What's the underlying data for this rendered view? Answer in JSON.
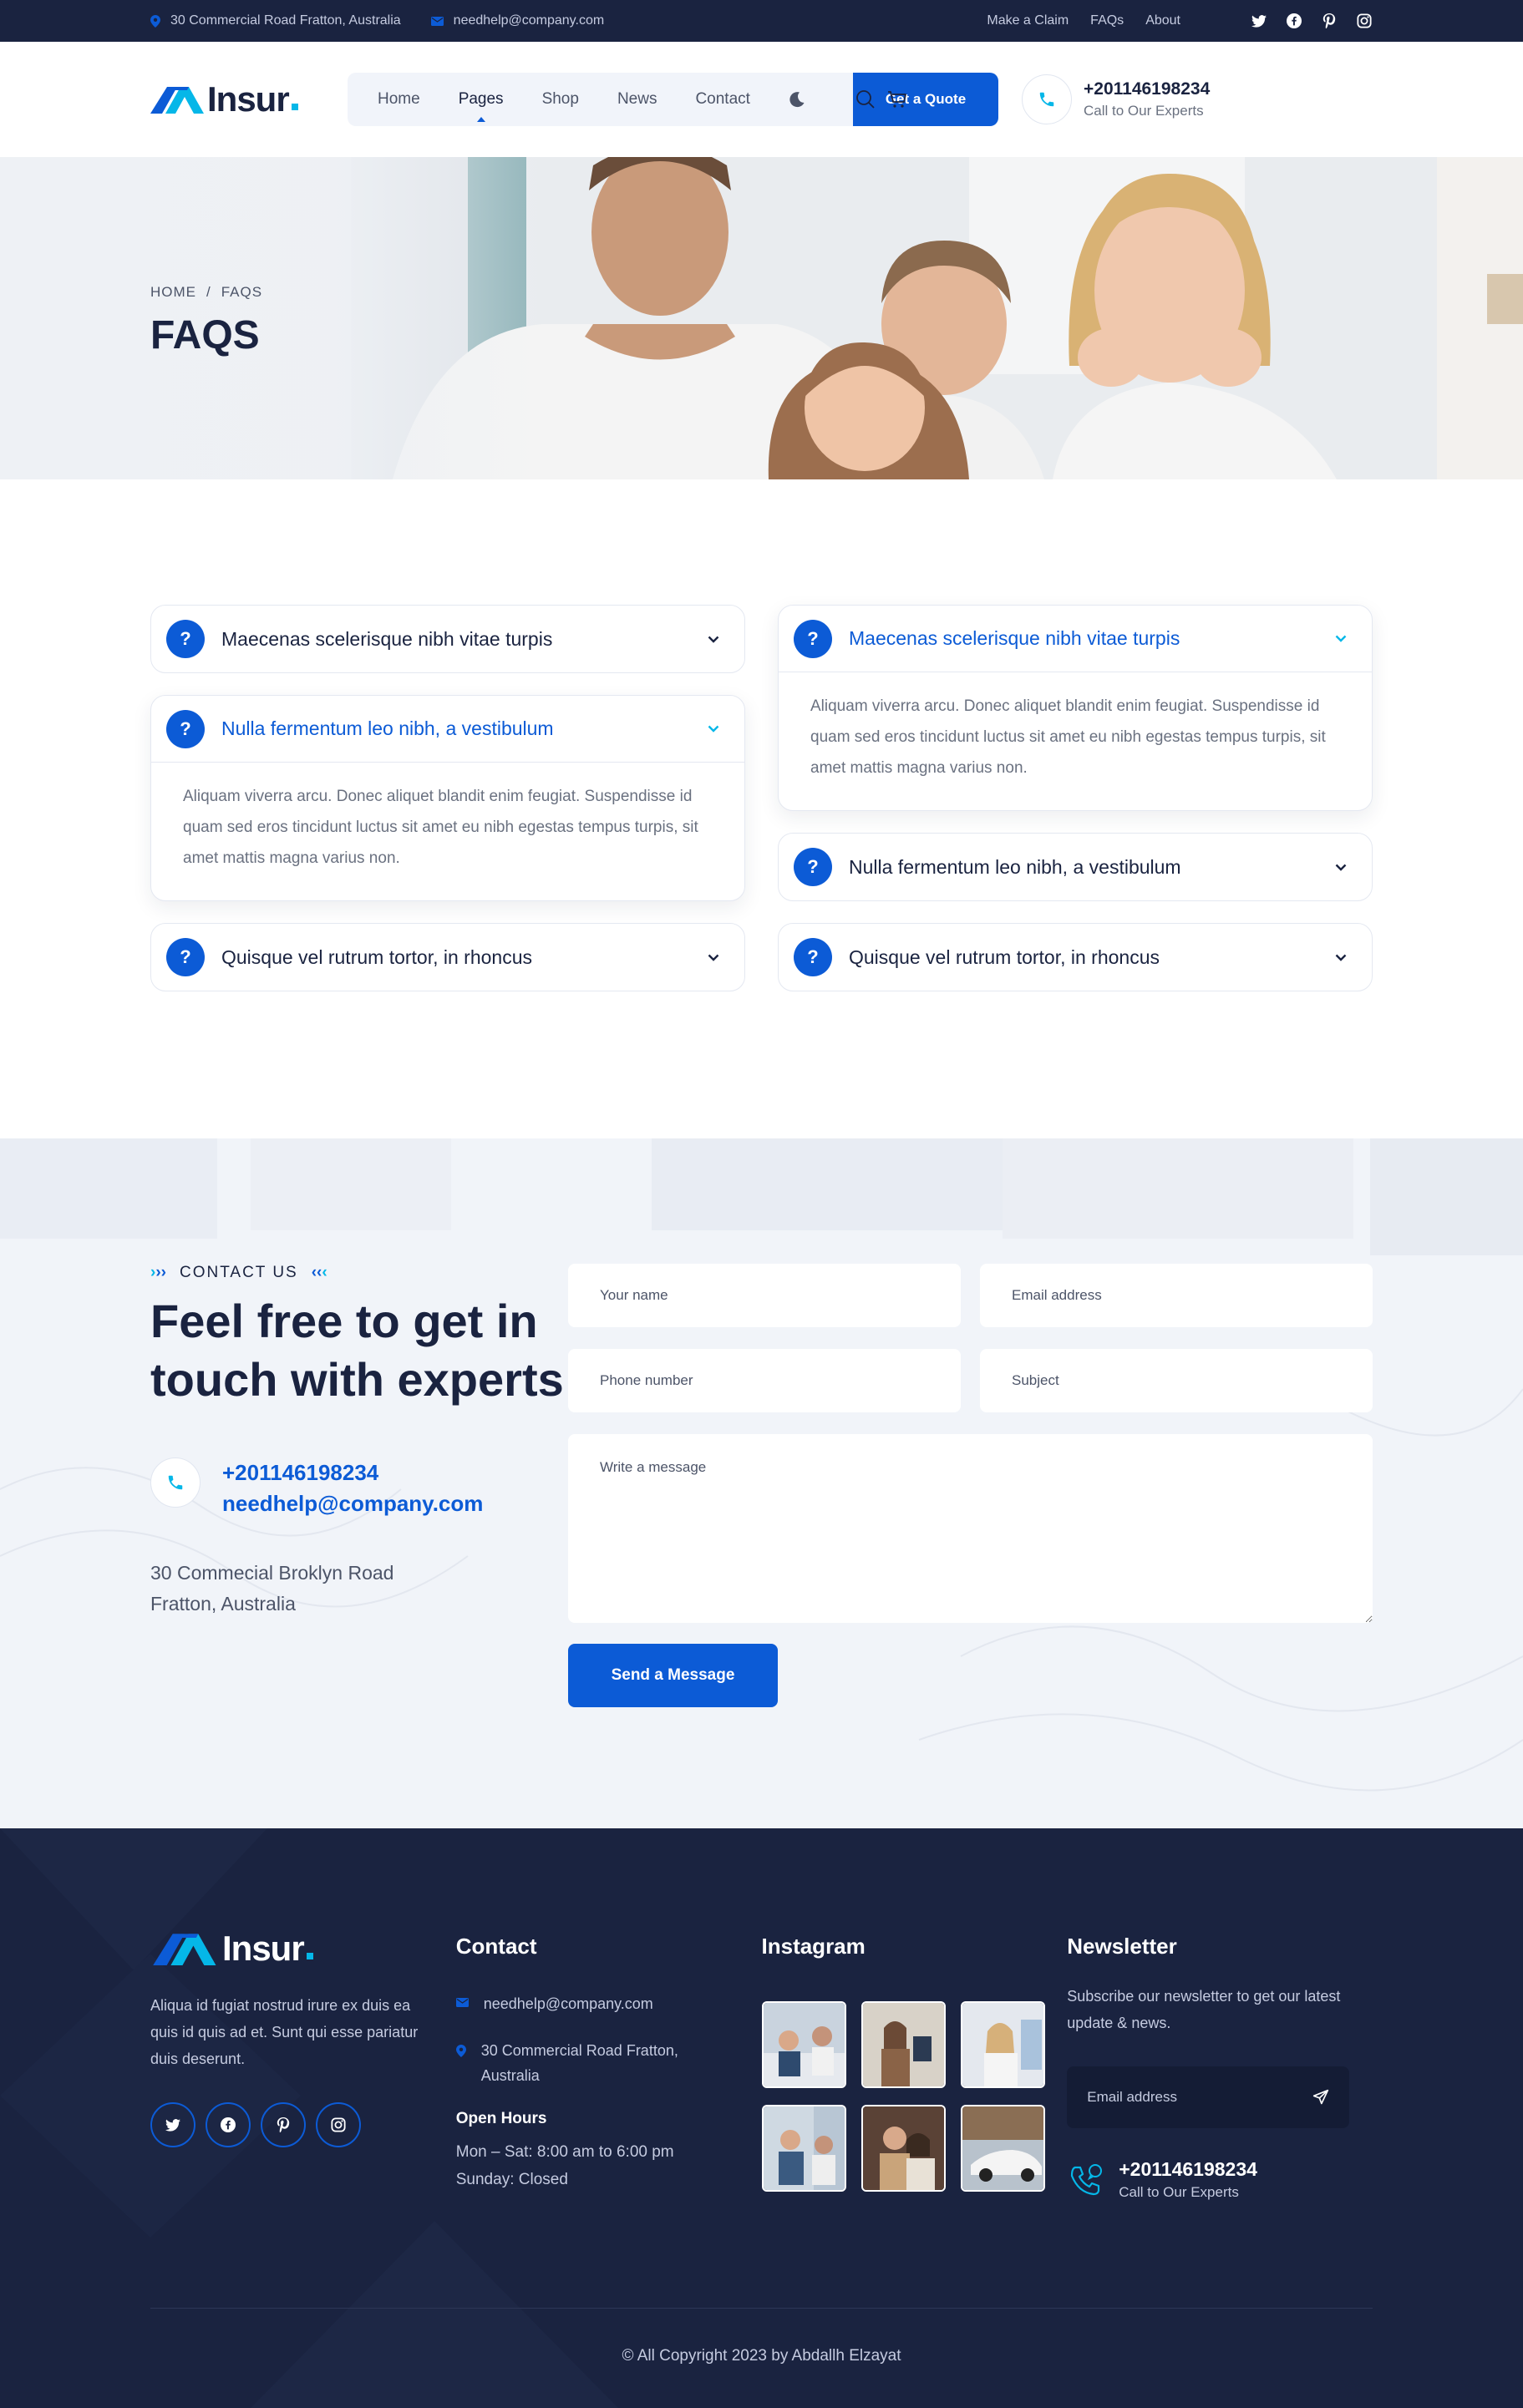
{
  "topbar": {
    "address": "30 Commercial Road Fratton, Australia",
    "email": "needhelp@company.com",
    "links": [
      "Make a Claim",
      "FAQs",
      "About"
    ]
  },
  "brand": {
    "name": "Insur",
    "accent": "#05b7e8",
    "primary": "#0c5bd6",
    "dark": "#1a2340"
  },
  "nav": {
    "items": [
      "Home",
      "Pages",
      "Shop",
      "News",
      "Contact"
    ],
    "active": "Pages",
    "quote_label": "Get a Quote",
    "phone": "+201146198234",
    "phone_caption": "Call to Our Experts"
  },
  "hero": {
    "breadcrumb_home": "HOME",
    "breadcrumb_sep": "/",
    "breadcrumb_current": "FAQS",
    "title": "FAQS"
  },
  "faq": {
    "left": [
      {
        "q": "Maecenas scelerisque nibh vitae turpis",
        "open": false
      },
      {
        "q": "Nulla fermentum leo nibh, a vestibulum",
        "open": true,
        "a": "Aliquam viverra arcu. Donec aliquet blandit enim feugiat. Suspendisse id quam sed eros tincidunt luctus sit amet eu nibh egestas tempus turpis, sit amet mattis magna varius non."
      },
      {
        "q": "Quisque vel rutrum tortor, in rhoncus",
        "open": false
      }
    ],
    "right": [
      {
        "q": "Maecenas scelerisque nibh vitae turpis",
        "open": true,
        "a": "Aliquam viverra arcu. Donec aliquet blandit enim feugiat. Suspendisse id quam sed eros tincidunt luctus sit amet eu nibh egestas tempus turpis, sit amet mattis magna varius non."
      },
      {
        "q": "Nulla fermentum leo nibh, a vestibulum",
        "open": false
      },
      {
        "q": "Quisque vel rutrum tortor, in rhoncus",
        "open": false
      }
    ],
    "qmark": "?"
  },
  "contact": {
    "tag": "CONTACT US",
    "title": "Feel free to get in touch with experts",
    "phone": "+201146198234",
    "email": "needhelp@company.com",
    "address_line1": "30 Commecial Broklyn Road",
    "address_line2": "Fratton, Australia",
    "form": {
      "name_placeholder": "Your name",
      "email_placeholder": "Email address",
      "phone_placeholder": "Phone number",
      "subject_placeholder": "Subject",
      "message_placeholder": "Write a message",
      "submit_label": "Send a Message"
    }
  },
  "footer": {
    "about": "Aliqua id fugiat nostrud irure ex duis ea quis id quis ad et. Sunt qui esse pariatur duis deserunt.",
    "contact_title": "Contact",
    "email": "needhelp@company.com",
    "address": "30 Commercial Road Fratton, Australia",
    "hours_title": "Open Hours",
    "hours_line1": "Mon – Sat: 8:00 am to 6:00 pm",
    "hours_line2": "Sunday: Closed",
    "instagram_title": "Instagram",
    "newsletter_title": "Newsletter",
    "newsletter_text": "Subscribe our newsletter to get our latest update & news.",
    "newsletter_placeholder": "Email address",
    "phone": "+201146198234",
    "phone_caption": "Call to Our Experts",
    "copyright": "© All Copyright 2023 by Abdallh Elzayat"
  },
  "icons": {
    "social": [
      "twitter-icon",
      "facebook-icon",
      "pinterest-icon",
      "instagram-icon"
    ]
  }
}
